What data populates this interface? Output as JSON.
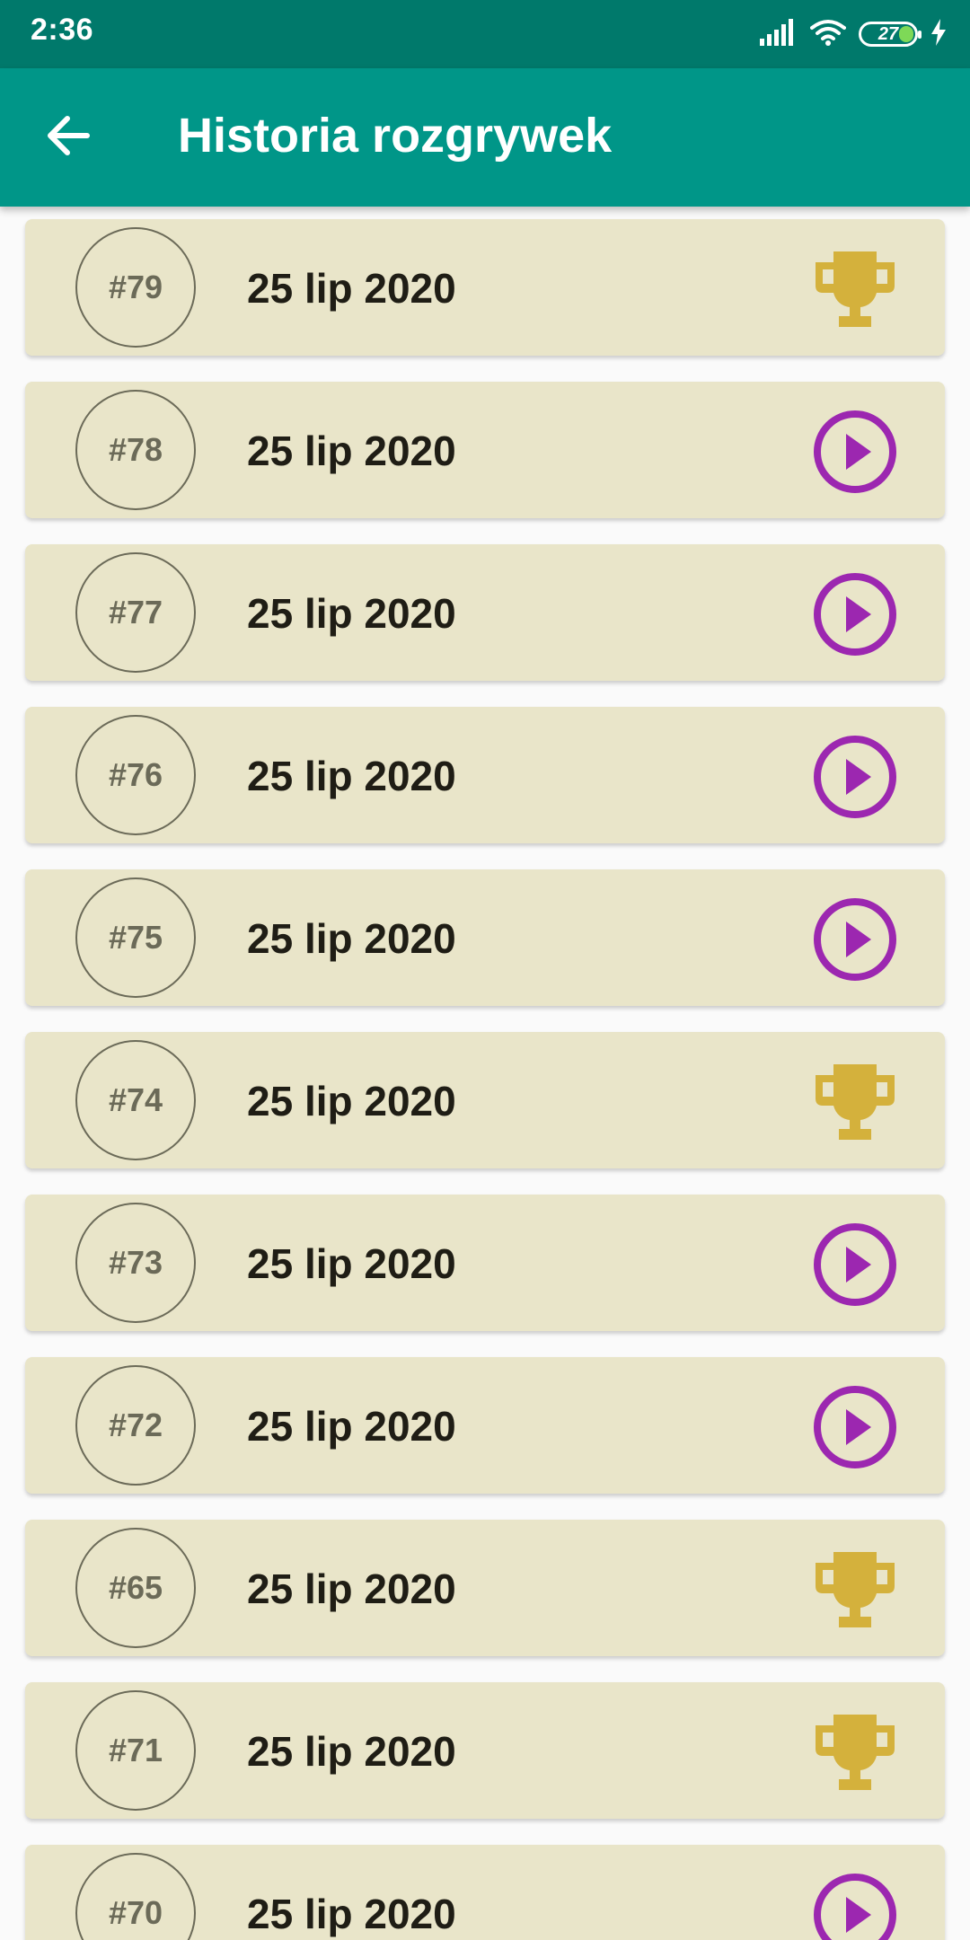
{
  "status_bar": {
    "time": "2:36",
    "battery": "27",
    "icons": [
      "signal-icon",
      "wifi-icon",
      "battery-icon",
      "charging-icon"
    ]
  },
  "app_bar": {
    "title": "Historia rozgrywek",
    "back_icon": "arrow-back-icon"
  },
  "colors": {
    "status_bar": "#00796b",
    "app_bar": "#009688",
    "card": "#e9e5c9",
    "trophy": "#d4b13c",
    "play": "#9c27b0"
  },
  "games": [
    {
      "number": "#79",
      "date": "25 lip 2020",
      "icon": "trophy-icon"
    },
    {
      "number": "#78",
      "date": "25 lip 2020",
      "icon": "play-circle-icon"
    },
    {
      "number": "#77",
      "date": "25 lip 2020",
      "icon": "play-circle-icon"
    },
    {
      "number": "#76",
      "date": "25 lip 2020",
      "icon": "play-circle-icon"
    },
    {
      "number": "#75",
      "date": "25 lip 2020",
      "icon": "play-circle-icon"
    },
    {
      "number": "#74",
      "date": "25 lip 2020",
      "icon": "trophy-icon"
    },
    {
      "number": "#73",
      "date": "25 lip 2020",
      "icon": "play-circle-icon"
    },
    {
      "number": "#72",
      "date": "25 lip 2020",
      "icon": "play-circle-icon"
    },
    {
      "number": "#65",
      "date": "25 lip 2020",
      "icon": "trophy-icon"
    },
    {
      "number": "#71",
      "date": "25 lip 2020",
      "icon": "trophy-icon"
    },
    {
      "number": "#70",
      "date": "25 lip 2020",
      "icon": "play-circle-icon"
    }
  ]
}
